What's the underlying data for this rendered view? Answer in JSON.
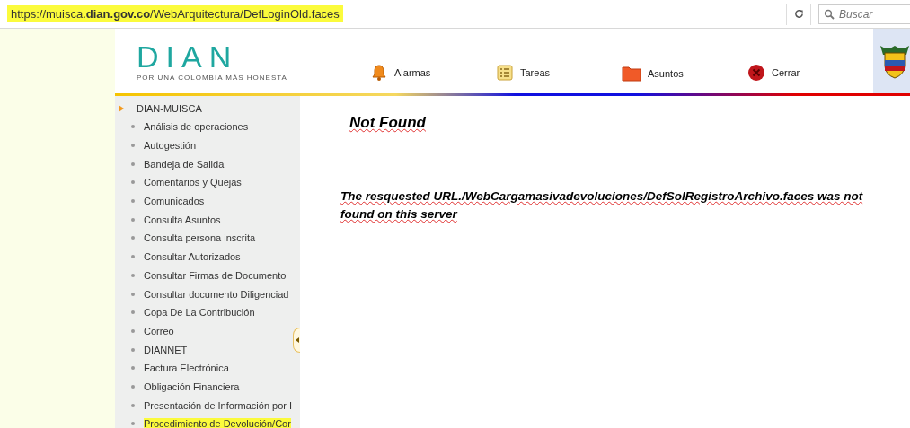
{
  "address_bar": {
    "url": "https://muisca.**dian.gov.co**/WebArquitectura/DefLoginOld.faces",
    "highlighted": true
  },
  "search": {
    "placeholder": "Buscar"
  },
  "logo": {
    "name": "DIAN",
    "tagline": "POR UNA COLOMBIA MÁS HONESTA"
  },
  "nav": [
    {
      "label": "Alarmas",
      "kind": "bell"
    },
    {
      "label": "Tareas",
      "kind": "tasks"
    },
    {
      "label": "Asuntos",
      "kind": "folder"
    },
    {
      "label": "Cerrar",
      "kind": "close"
    }
  ],
  "sidebar": {
    "root": "DIAN-MUISCA",
    "items": [
      {
        "label": "Análisis de operaciones",
        "highlighted": false
      },
      {
        "label": "Autogestión",
        "highlighted": false
      },
      {
        "label": "Bandeja de Salida",
        "highlighted": false
      },
      {
        "label": "Comentarios y Quejas",
        "highlighted": false
      },
      {
        "label": "Comunicados",
        "highlighted": false
      },
      {
        "label": "Consulta Asuntos",
        "highlighted": false
      },
      {
        "label": "Consulta persona inscrita",
        "highlighted": false
      },
      {
        "label": "Consultar Autorizados",
        "highlighted": false
      },
      {
        "label": "Consultar Firmas de Documento",
        "highlighted": false
      },
      {
        "label": "Consultar documento Diligenciad",
        "highlighted": false
      },
      {
        "label": "Copa De La Contribución",
        "highlighted": false
      },
      {
        "label": "Correo",
        "highlighted": false
      },
      {
        "label": "DIANNET",
        "highlighted": false
      },
      {
        "label": "Factura Electrónica",
        "highlighted": false
      },
      {
        "label": "Obligación Financiera",
        "highlighted": false
      },
      {
        "label": "Presentación de Información por I",
        "highlighted": false
      },
      {
        "label": "Procedimiento de Devolución/Cor",
        "highlighted": true
      }
    ]
  },
  "error": {
    "title": "Not Found",
    "message": "The resquested URL./WebCargamasivadevoluciones/DefSolRegistroArchivo.faces was not found on this server"
  }
}
